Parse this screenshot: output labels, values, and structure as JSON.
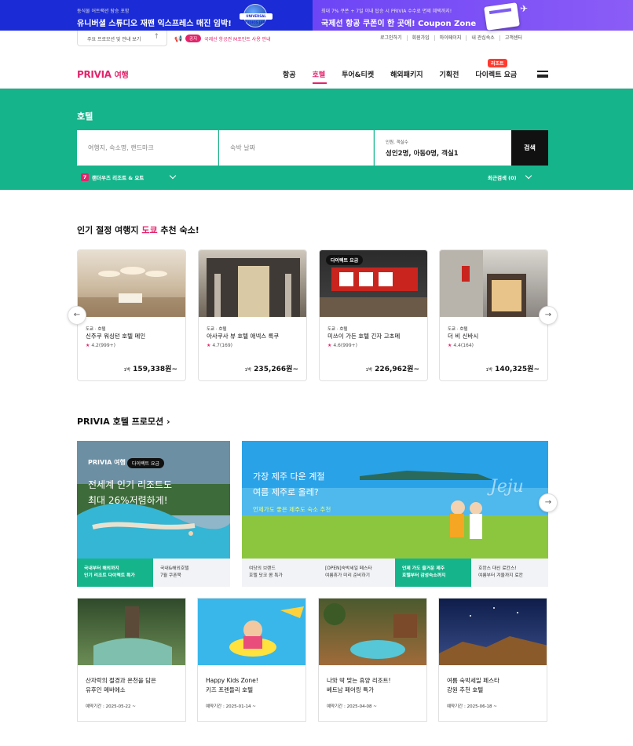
{
  "banners": {
    "left": {
      "small": "동식물 어트랙션 탐승 포함",
      "big": "유니버셜 스튜디오 재팬 익스프레스 매진 임박!",
      "badge": "UNIVERSAL STUDIOS JAPAN"
    },
    "right": {
      "small": "최대 7% 쿠폰 + 7일 이내 탑승 시 PRIVIA 수수료 면제 혜택까지!",
      "big": "국제선 항공 쿠폰이 한 곳에! Coupon Zone"
    }
  },
  "utility": {
    "main_promo": "주요 프로모션 및 안내 보기",
    "notice_tag": "공지",
    "notice_text": "국제선 항공권 M포인트 사용 안내",
    "links": [
      "로그인하기",
      "회원가입",
      "마이페이지",
      "내 관심숙소",
      "고객센터"
    ]
  },
  "header": {
    "logo_main": "PRIVIA",
    "logo_sub": "여행",
    "nav": [
      "항공",
      "호텔",
      "투어&티켓",
      "해외패키지",
      "기획전",
      "다이렉트 요금"
    ],
    "active_nav": "호텔",
    "resort_tag": "리조트"
  },
  "search": {
    "title": "호텔",
    "destination_placeholder": "여행지, 숙소명, 랜드마크",
    "date_placeholder": "숙박 날짜",
    "guests_label": "인원, 객실수",
    "guests_value": "성인2명,  아동0명,  객실1",
    "button": "검색",
    "promo_badge": "7",
    "promo_text": "랜더우즈 리조트 & 요트",
    "recent_search": "최근검색 (0)"
  },
  "popular": {
    "title_prefix": "인기 절정 여행지 ",
    "title_highlight": "도쿄",
    "title_suffix": " 추천 숙소!",
    "hotels": [
      {
        "loc": "도쿄 · 호텔",
        "name": "신주쿠 워싱턴 호텔 메인",
        "rating": "4.2",
        "reviews": "(999+)",
        "price_prefix": "1박",
        "price": "159,338원~"
      },
      {
        "loc": "도쿄 · 호텔",
        "name": "아사쿠사 뷰 호텔 애넥스 록쿠",
        "rating": "4.7",
        "reviews": "(169)",
        "price_prefix": "1박",
        "price": "235,266원~"
      },
      {
        "loc": "도쿄 · 호텔",
        "name": "미쓰이 가든 호텔 긴자 고초메",
        "rating": "4.6",
        "reviews": "(999+)",
        "price_prefix": "1박",
        "price": "226,962원~",
        "tag": "다이렉트 요금"
      },
      {
        "loc": "도쿄 · 호텔",
        "name": "더 비 신바시",
        "rating": "4.4",
        "reviews": "(164)",
        "price_prefix": "1박",
        "price": "140,325원~"
      }
    ]
  },
  "promotions": {
    "title": "PRIVIA 호텔 프로모션",
    "left_banner": {
      "logo": "PRIVIA 여행",
      "tag": "다이렉트 요금",
      "line1": "전세계 인기 리조트도",
      "line2": "최대 26%저렴하게!"
    },
    "right_banner": {
      "line1": "가장 제주 다운 계절",
      "line2": "여름 제주로 올레?",
      "sub": "언제가도 좋은 제주도 숙소 추천",
      "script": "Jeju"
    },
    "tabs": [
      {
        "l1": "국내부터 해외까지",
        "l2": "인기 리조트 다이렉트 특가",
        "on": true
      },
      {
        "l1": "국내&해외호텔",
        "l2": "7월 쿠폰북",
        "on": false
      },
      {
        "l1": "여당의 브랜드",
        "l2": "호텔 닷코 콤 특가",
        "on": false
      },
      {
        "l1": "[OPEN]숙박세일 페스타",
        "l2": "여름휴가 미리 준비하기",
        "on": false
      },
      {
        "l1": "언제 가도 즐거운 제주",
        "l2": "호텔부터 감성숙소까지",
        "on": true
      },
      {
        "l1": "호캉스 대신 료칸스!",
        "l2": "여름부터 겨울까지 료칸",
        "on": false
      }
    ],
    "cards": [
      {
        "t1": "산자락의 절경과 온천을 담은",
        "t2": "유후인 메바에소",
        "date": "예약기간 : 2025-05-22 ~"
      },
      {
        "t1": "Happy Kids Zone!",
        "t2": "키즈 프렌들리 호텔",
        "date": "예약기간 : 2025-01-14 ~"
      },
      {
        "t1": "나와 딱 맞는 휴양 리조트!",
        "t2": "베트남 페어링 특가",
        "date": "예약기간 : 2025-04-08 ~"
      },
      {
        "t1": "여름 숙박세일 페스타",
        "t2": "강원 추천 호텔",
        "date": "예약기간 : 2025-06-18 ~"
      }
    ]
  },
  "colors": {
    "brand": "#e3246b",
    "teal": "#16b48b",
    "dark": "#111111"
  }
}
